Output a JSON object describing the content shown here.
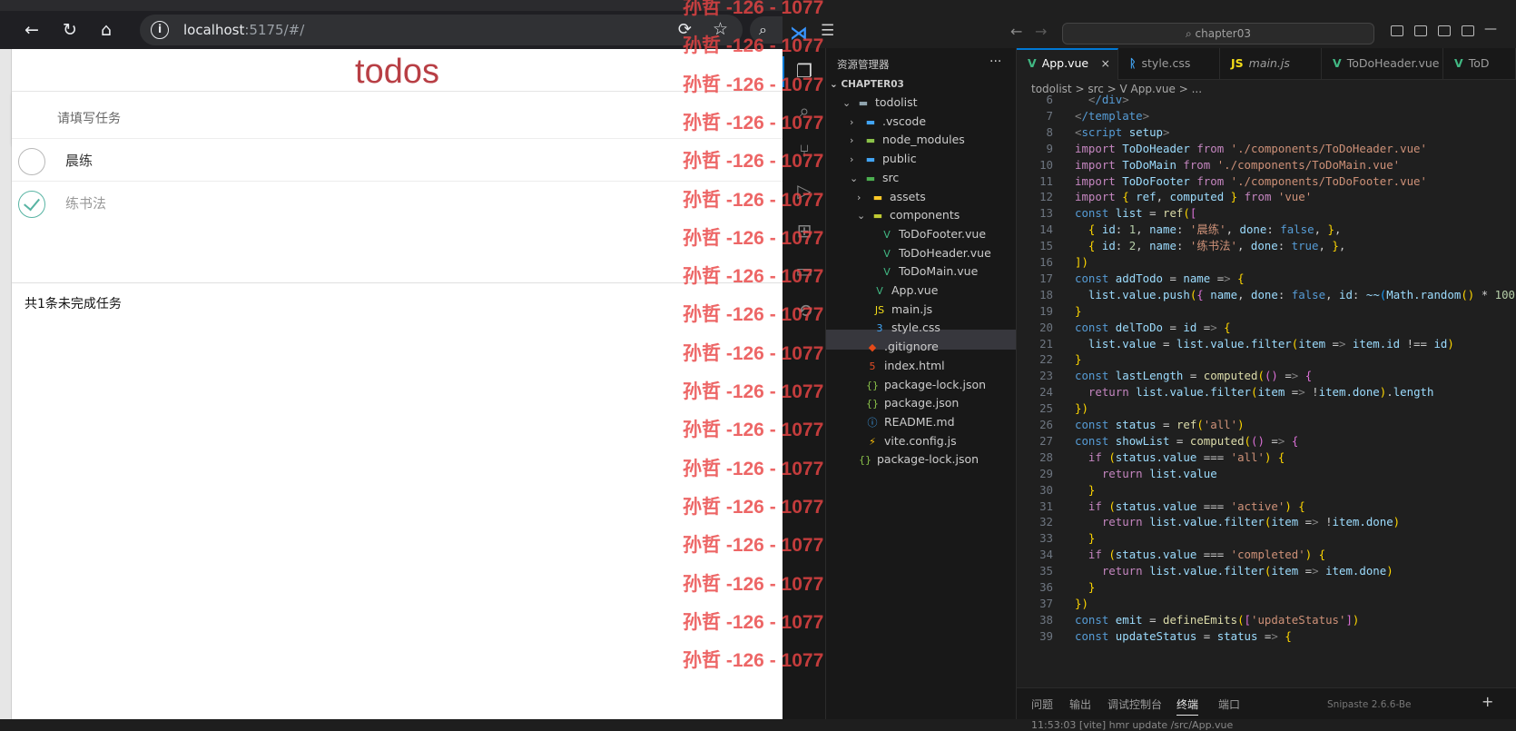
{
  "browser": {
    "url_host": "localhost",
    "url_path": ":5175/#/"
  },
  "todo_app": {
    "title": "todos",
    "input_placeholder": "请填写任务",
    "items": [
      {
        "name": "晨练",
        "done": false
      },
      {
        "name": "练书法",
        "done": true
      }
    ],
    "footer": "共1条未完成任务"
  },
  "watermark": "孙哲 -126 - 1077",
  "vscode": {
    "search": "chapter03",
    "explorer_title": "资源管理器",
    "root": "CHAPTER03",
    "tree": [
      {
        "label": "todolist",
        "kind": "folder-open",
        "depth": 1,
        "icon": "folder-icon"
      },
      {
        "label": ".vscode",
        "kind": "folder",
        "depth": 2,
        "icon": "vscode-folder-icon"
      },
      {
        "label": "node_modules",
        "kind": "folder",
        "depth": 2,
        "icon": "node-folder-icon"
      },
      {
        "label": "public",
        "kind": "folder",
        "depth": 2,
        "icon": "public-folder-icon"
      },
      {
        "label": "src",
        "kind": "folder-open",
        "depth": 2,
        "icon": "src-folder-icon"
      },
      {
        "label": "assets",
        "kind": "folder",
        "depth": 3,
        "icon": "assets-folder-icon"
      },
      {
        "label": "components",
        "kind": "folder-open",
        "depth": 3,
        "icon": "components-folder-icon"
      },
      {
        "label": "ToDoFooter.vue",
        "kind": "file",
        "depth": 4,
        "icon": "vue-file-icon"
      },
      {
        "label": "ToDoHeader.vue",
        "kind": "file",
        "depth": 4,
        "icon": "vue-file-icon"
      },
      {
        "label": "ToDoMain.vue",
        "kind": "file",
        "depth": 4,
        "icon": "vue-file-icon"
      },
      {
        "label": "App.vue",
        "kind": "file",
        "depth": 3,
        "icon": "vue-file-icon"
      },
      {
        "label": "main.js",
        "kind": "file",
        "depth": 3,
        "icon": "js-file-icon"
      },
      {
        "label": "style.css",
        "kind": "file",
        "depth": 3,
        "icon": "css-file-icon"
      },
      {
        "label": ".gitignore",
        "kind": "file",
        "depth": 2,
        "icon": "git-file-icon"
      },
      {
        "label": "index.html",
        "kind": "file",
        "depth": 2,
        "icon": "html-file-icon"
      },
      {
        "label": "package-lock.json",
        "kind": "file",
        "depth": 2,
        "icon": "json-file-icon"
      },
      {
        "label": "package.json",
        "kind": "file",
        "depth": 2,
        "icon": "json-file-icon"
      },
      {
        "label": "README.md",
        "kind": "file",
        "depth": 2,
        "icon": "info-file-icon"
      },
      {
        "label": "vite.config.js",
        "kind": "file",
        "depth": 2,
        "icon": "vite-file-icon"
      },
      {
        "label": "package-lock.json",
        "kind": "file",
        "depth": 1,
        "icon": "json-file-icon"
      }
    ],
    "tabs": [
      {
        "label": "App.vue",
        "icon": "vue-file-icon",
        "active": true
      },
      {
        "label": "style.css",
        "icon": "css-file-icon",
        "active": false
      },
      {
        "label": "main.js",
        "icon": "js-file-icon",
        "active": false
      },
      {
        "label": "ToDoHeader.vue",
        "icon": "vue-file-icon",
        "active": false
      },
      {
        "label": "ToD",
        "icon": "vue-file-icon",
        "active": false
      }
    ],
    "breadcrumb": "todolist  >  src  >  V App.vue  >  ...",
    "code_lines": [
      {
        "n": 6,
        "text": "  </div>"
      },
      {
        "n": 7,
        "text": "</template>"
      },
      {
        "n": 8,
        "text": "<script setup>"
      },
      {
        "n": 9,
        "text": "import ToDoHeader from './components/ToDoHeader.vue'"
      },
      {
        "n": 10,
        "text": "import ToDoMain from './components/ToDoMain.vue'"
      },
      {
        "n": 11,
        "text": "import ToDoFooter from './components/ToDoFooter.vue'"
      },
      {
        "n": 12,
        "text": "import { ref, computed } from 'vue'"
      },
      {
        "n": 13,
        "text": "const list = ref(["
      },
      {
        "n": 14,
        "text": "  { id: 1, name: '晨练', done: false, },"
      },
      {
        "n": 15,
        "text": "  { id: 2, name: '练书法', done: true, },"
      },
      {
        "n": 16,
        "text": "])"
      },
      {
        "n": 17,
        "text": "const addTodo = name => {"
      },
      {
        "n": 18,
        "text": "  list.value.push({ name, done: false, id: ~~(Math.random() * 100"
      },
      {
        "n": 19,
        "text": "}"
      },
      {
        "n": 20,
        "text": "const delToDo = id => {"
      },
      {
        "n": 21,
        "text": "  list.value = list.value.filter(item => item.id !== id)"
      },
      {
        "n": 22,
        "text": "}"
      },
      {
        "n": 23,
        "text": "const lastLength = computed(() => {"
      },
      {
        "n": 24,
        "text": "  return list.value.filter(item => !item.done).length"
      },
      {
        "n": 25,
        "text": "})"
      },
      {
        "n": 26,
        "text": "const status = ref('all')"
      },
      {
        "n": 27,
        "text": "const showList = computed(() => {"
      },
      {
        "n": 28,
        "text": "  if (status.value === 'all') {"
      },
      {
        "n": 29,
        "text": "    return list.value"
      },
      {
        "n": 30,
        "text": "  }"
      },
      {
        "n": 31,
        "text": "  if (status.value === 'active') {"
      },
      {
        "n": 32,
        "text": "    return list.value.filter(item => !item.done)"
      },
      {
        "n": 33,
        "text": "  }"
      },
      {
        "n": 34,
        "text": "  if (status.value === 'completed') {"
      },
      {
        "n": 35,
        "text": "    return list.value.filter(item => item.done)"
      },
      {
        "n": 36,
        "text": "  }"
      },
      {
        "n": 37,
        "text": "})"
      },
      {
        "n": 38,
        "text": "const emit = defineEmits(['updateStatus'])"
      },
      {
        "n": 39,
        "text": "const updateStatus = status => {"
      }
    ],
    "panel_tabs": [
      "问题",
      "输出",
      "调试控制台",
      "终端",
      "端口"
    ],
    "panel_active": "终端",
    "terminal_line": "11:53:03 [vite] hmr update /src/App.vue",
    "snipaste": "Snipaste 2.6.6-Be"
  },
  "colors": {
    "todos_title": "#b83f45",
    "watermark": "#e94444",
    "vscode_accent": "#0078d4"
  }
}
